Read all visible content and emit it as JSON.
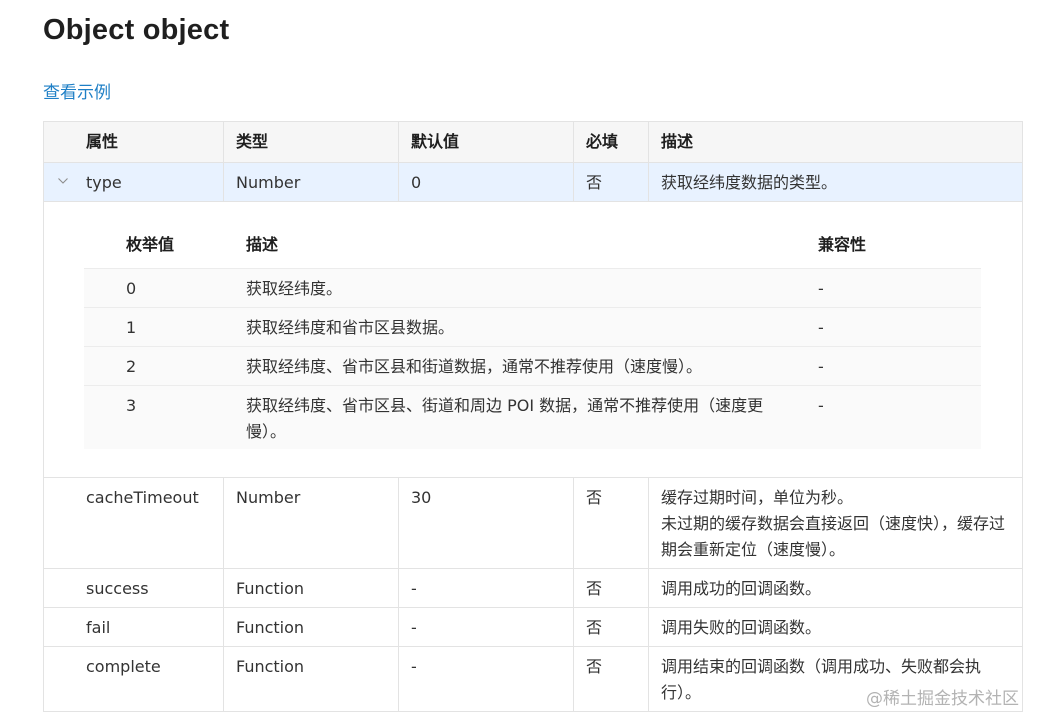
{
  "page": {
    "title": "Object object",
    "example_link": "查看示例"
  },
  "props_table": {
    "headers": [
      "属性",
      "类型",
      "默认值",
      "必填",
      "描述"
    ],
    "rows": [
      {
        "name": "type",
        "type": "Number",
        "default": "0",
        "required": "否",
        "desc": "获取经纬度数据的类型。",
        "expanded": true
      },
      {
        "name": "cacheTimeout",
        "type": "Number",
        "default": "30",
        "required": "否",
        "desc": "缓存过期时间，单位为秒。\n未过期的缓存数据会直接返回（速度快），缓存过期会重新定位（速度慢）。"
      },
      {
        "name": "success",
        "type": "Function",
        "default": "-",
        "required": "否",
        "desc": "调用成功的回调函数。"
      },
      {
        "name": "fail",
        "type": "Function",
        "default": "-",
        "required": "否",
        "desc": "调用失败的回调函数。"
      },
      {
        "name": "complete",
        "type": "Function",
        "default": "-",
        "required": "否",
        "desc": "调用结束的回调函数（调用成功、失败都会执行）。"
      }
    ]
  },
  "enum_table": {
    "headers": [
      "枚举值",
      "描述",
      "兼容性"
    ],
    "rows": [
      {
        "value": "0",
        "desc": "获取经纬度。",
        "compat": "-"
      },
      {
        "value": "1",
        "desc": "获取经纬度和省市区县数据。",
        "compat": "-"
      },
      {
        "value": "2",
        "desc": "获取经纬度、省市区县和街道数据，通常不推荐使用（速度慢）。",
        "compat": "-"
      },
      {
        "value": "3",
        "desc": "获取经纬度、省市区县、街道和周边 POI 数据，通常不推荐使用（速度更慢）。",
        "compat": "-"
      }
    ]
  },
  "watermark": "@稀土掘金技术社区",
  "icons": {
    "expand": "chevron-down-icon"
  },
  "colors": {
    "link": "#1e7fc6",
    "expanded_row": "#e8f2ff",
    "header_bg": "#f6f6f6"
  }
}
